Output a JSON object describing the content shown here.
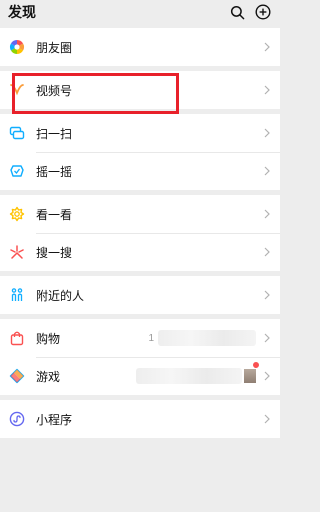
{
  "header": {
    "title": "发现",
    "icons": [
      "search-icon",
      "add-circle-icon"
    ]
  },
  "groups": [
    [
      {
        "label": "朋友圈",
        "icon": "moments-icon"
      }
    ],
    [
      {
        "label": "视频号",
        "icon": "channels-icon"
      }
    ],
    [
      {
        "label": "扫一扫",
        "icon": "scan-icon"
      },
      {
        "label": "摇一摇",
        "icon": "shake-icon"
      }
    ],
    [
      {
        "label": "看一看",
        "icon": "top-stories-icon"
      },
      {
        "label": "搜一搜",
        "icon": "search-sparkle-icon"
      }
    ],
    [
      {
        "label": "附近的人",
        "icon": "people-nearby-icon"
      }
    ],
    [
      {
        "label": "购物",
        "icon": "shopping-bag-icon",
        "prefix": "1"
      },
      {
        "label": "游戏",
        "icon": "games-icon"
      }
    ],
    [
      {
        "label": "小程序",
        "icon": "mini-programs-icon"
      }
    ]
  ],
  "colors": {
    "highlight": "#e8202a",
    "badge": "#fa5151"
  }
}
